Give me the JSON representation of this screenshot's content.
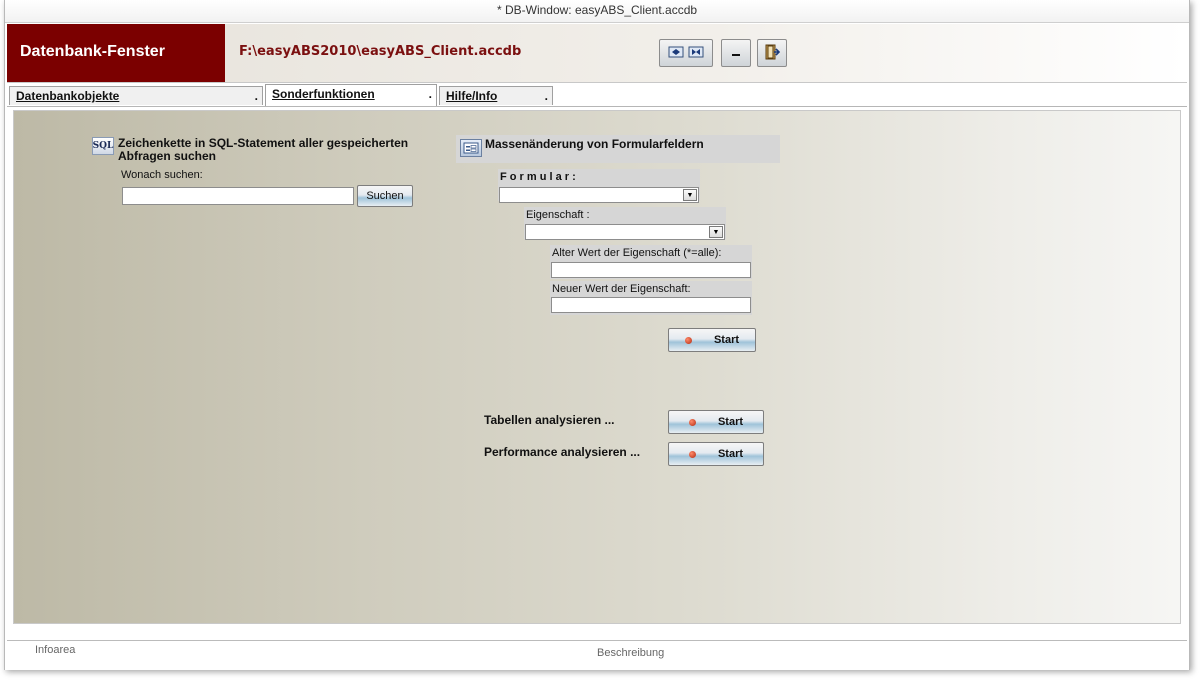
{
  "window": {
    "title": "* DB-Window: easyABS_Client.accdb"
  },
  "header": {
    "title": "Datenbank-Fenster",
    "path": "F:\\easyABS2010\\easyABS_Client.accdb",
    "buttons": [
      {
        "icon": "expand-collapse-icon"
      },
      {
        "icon": "minimize-icon"
      },
      {
        "icon": "exit-door-icon"
      }
    ]
  },
  "tabs": [
    {
      "label": "Datenbankobjekte",
      "active": false
    },
    {
      "label": "Sonderfunktionen",
      "active": true
    },
    {
      "label": "Hilfe/Info",
      "active": false
    }
  ],
  "sql_search": {
    "icon_text": "SQL",
    "title_line1": "Zeichenkette in SQL-Statement aller gespeicherten",
    "title_line2": "Abfragen suchen",
    "search_label": "Wonach suchen:",
    "search_value": "",
    "button_label": "Suchen"
  },
  "mass_change": {
    "title": "Massenänderung von Formularfeldern",
    "formular_label": "F o r m u l a r :",
    "formular_value": "",
    "property_label": "Eigenschaft :",
    "property_value": "",
    "old_value_label": "Alter Wert der Eigenschaft (*=alle):",
    "old_value": "",
    "new_value_label": "Neuer Wert der Eigenschaft:",
    "new_value": "",
    "start_label": "Start"
  },
  "analysis": {
    "tables_label": "Tabellen analysieren ...",
    "tables_button": "Start",
    "performance_label": "Performance analysieren ...",
    "performance_button": "Start"
  },
  "status": {
    "left": "Infoarea",
    "center": "Beschreibung"
  }
}
